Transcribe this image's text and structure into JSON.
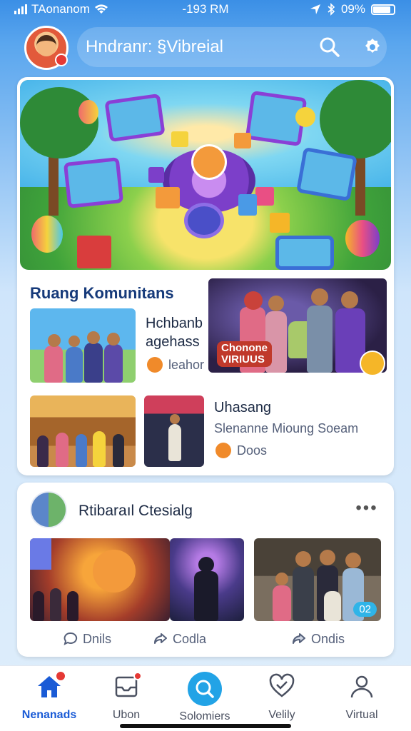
{
  "status_bar": {
    "carrier": "TAonanom",
    "time": "-193 RM",
    "battery": "09%"
  },
  "header": {
    "title": "Hndranr: §Vibreial"
  },
  "community": {
    "section_title": "Ruang Komunitans",
    "item1": {
      "title": "Hchbanb",
      "subtitle": "agehass",
      "meta": "leahor"
    },
    "feature": {
      "label": "Chonone\nVIRIUUS"
    },
    "item2": {
      "title": "Uhasang",
      "subtitle": "Slenanne  Mioung  Soeam",
      "meta": "Doos"
    }
  },
  "group_post": {
    "title": "Rtibaraıl Ctesialg",
    "more_label": "•••",
    "badge": "02",
    "actions": [
      {
        "label": "Dnils"
      },
      {
        "label": "Codla"
      },
      {
        "label": "Ondis"
      }
    ]
  },
  "nav": {
    "items": [
      {
        "label": "Nenanads",
        "icon": "home-icon"
      },
      {
        "label": "Ubon",
        "icon": "inbox-icon"
      },
      {
        "label": "Solomiers",
        "icon": "discover-icon"
      },
      {
        "label": "Velily",
        "icon": "heart-check-icon"
      },
      {
        "label": "Virtual",
        "icon": "profile-icon"
      }
    ]
  },
  "colors": {
    "accent": "#1a5bd6",
    "center_button": "#22a3e6",
    "notification": "#e53935"
  }
}
